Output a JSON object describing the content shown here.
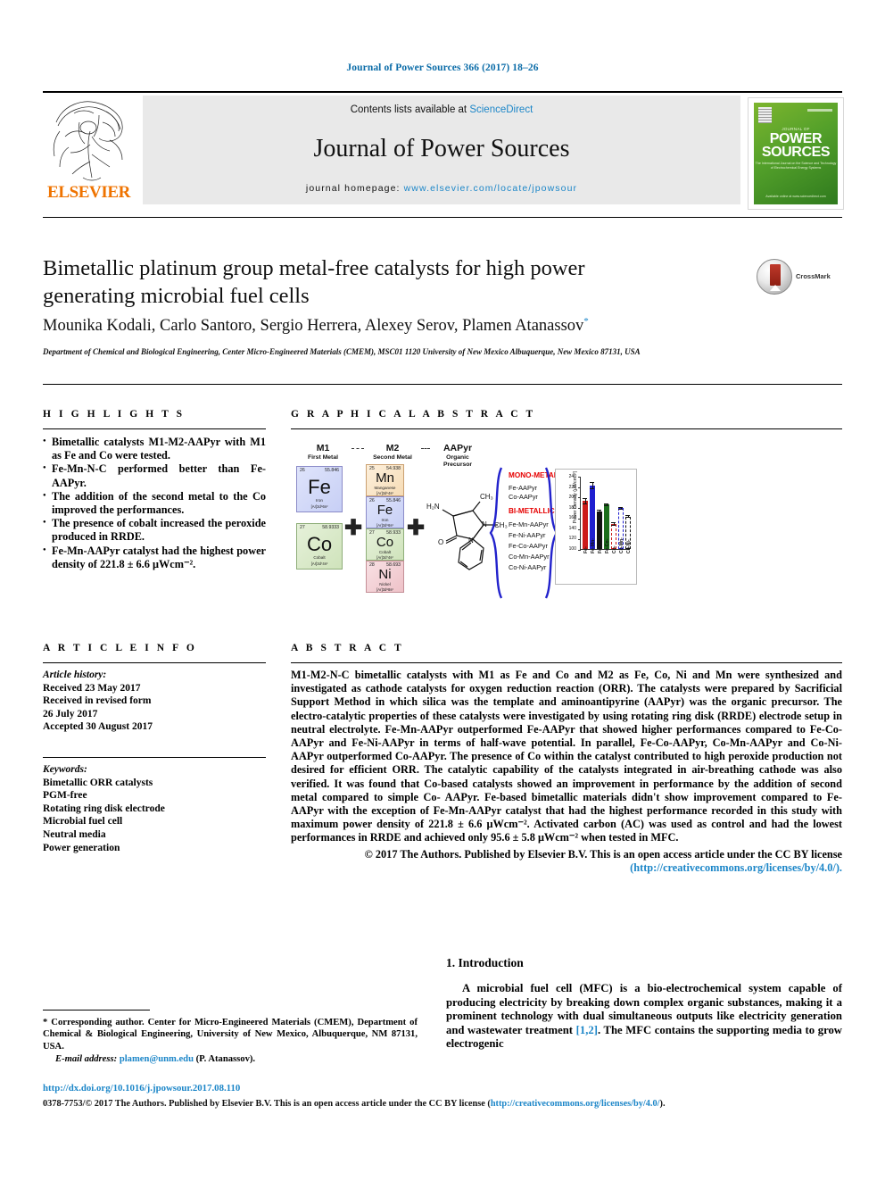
{
  "running_head": "Journal of Power Sources 366 (2017) 18–26",
  "masthead": {
    "publisher": "ELSEVIER",
    "contents_prefix": "Contents lists available at ",
    "contents_link": "ScienceDirect",
    "journal_name": "Journal of Power Sources",
    "homepage_prefix": "journal homepage: ",
    "homepage_url": "www.elsevier.com/locate/jpowsour",
    "cover": {
      "supertitle": "JOURNAL OF",
      "title_line1": "POWER",
      "title_line2": "SOURCES",
      "blurb": "The International Journal on the Science and Technology of Electrochemical Energy Systems",
      "footer": "Available online at www.sciencedirect.com"
    }
  },
  "article": {
    "title": "Bimetallic platinum group metal-free catalysts for high power generating microbial fuel cells",
    "authors": "Mounika Kodali, Carlo Santoro, Sergio Herrera, Alexey Serov, Plamen Atanassov",
    "author_marker": "*",
    "affiliation": "Department of Chemical and Biological Engineering, Center Micro-Engineered Materials (CMEM), MSC01 1120 University of New Mexico Albuquerque, New Mexico 87131, USA",
    "crossmark_label": "CrossMark"
  },
  "highlights": {
    "heading": "H I G H L I G H T S",
    "items": [
      "Bimetallic catalysts M1-M2-AAPyr with M1 as Fe and Co were tested.",
      "Fe-Mn-N-C performed better than Fe-AAPyr.",
      "The addition of the second metal to the Co improved the performances.",
      "The presence of cobalt increased the peroxide produced in RRDE.",
      "Fe-Mn-AAPyr catalyst had the highest power density of 221.8 ± 6.6 μWcm⁻²."
    ]
  },
  "graphical_abstract": {
    "heading": "G R A P H I C A L   A B S T R A C T",
    "columns": [
      {
        "label": "M1",
        "sub": "First Metal"
      },
      {
        "label": "M2",
        "sub": "Second Metal"
      },
      {
        "label": "AAPyr",
        "sub": "Organic\nPrecursor"
      }
    ],
    "m1_elements": [
      {
        "number": "26",
        "mass": "55.846",
        "symbol": "Fe",
        "name": "Iron",
        "config": "[Ar]3d⁶6s²"
      },
      {
        "number": "27",
        "mass": "58.9333",
        "symbol": "Co",
        "name": "Cobalt",
        "config": "[Ar]3d⁷4s²"
      }
    ],
    "m2_elements": [
      {
        "number": "25",
        "mass": "54.938",
        "symbol": "Mn",
        "name": "Manganese",
        "config": "[Ar]3d⁵4s²"
      },
      {
        "number": "26",
        "mass": "55.846",
        "symbol": "Fe",
        "name": "Iron",
        "config": "[Ar]3d⁶6s²"
      },
      {
        "number": "27",
        "mass": "58.933",
        "symbol": "Co",
        "name": "Cobalt",
        "config": "[Ar]3d⁷4s²"
      },
      {
        "number": "28",
        "mass": "58.693",
        "symbol": "Ni",
        "name": "Nickel",
        "config": "[Ar]3d⁸8s²"
      }
    ],
    "plus_symbol": "✚",
    "molecule": {
      "label_nh2": "H₂N",
      "label_ch3_a": "CH₃",
      "label_ch3_b": "CH₃",
      "label_n": "N",
      "label_o": "O"
    },
    "mono_title": "MONO-METALLIC",
    "mono_items": [
      "Fe-AAPyr",
      "Co-AAPyr"
    ],
    "bi_title": "BI-METALLIC",
    "bi_items": [
      "Fe-Mn-AAPyr",
      "Fe-Ni-AAPyr",
      "Fe-Co-AAPyr",
      "Co-Mn-AAPyr",
      "Co-Ni-AAPyr"
    ]
  },
  "chart_data": {
    "type": "bar",
    "title": "",
    "xlabel": "",
    "ylabel": "Power Density (μWcm⁻²)",
    "ylim": [
      100,
      240
    ],
    "yticks": [
      240,
      220,
      200,
      180,
      160,
      140,
      120,
      100
    ],
    "grid": false,
    "legend": "none",
    "categories": [
      "Fe-",
      "Fe-Mn-",
      "Fe-Ni-",
      "Fe-Co-",
      "Co-",
      "Co-Mn-",
      "Co-Ni-"
    ],
    "values": [
      192,
      221.8,
      172,
      185,
      148,
      178,
      162
    ],
    "errors": [
      6.0,
      6.6,
      3.0,
      2.5,
      3.0,
      3.0,
      3.0
    ],
    "bar_colors": [
      "#cc1b1b",
      "#1f1fd0",
      "#111111",
      "#1c6e1c",
      "#cc1b1b",
      "#1f1fd0",
      "#111111"
    ],
    "bar_fill": [
      "solid",
      "solid",
      "solid",
      "solid",
      "hollow",
      "hollow",
      "hollow"
    ]
  },
  "article_info": {
    "heading": "A R T I C L E   I N F O",
    "history_label": "Article history:",
    "history": [
      "Received 23 May 2017",
      "Received in revised form",
      "26 July 2017",
      "Accepted 30 August 2017"
    ],
    "keywords_label": "Keywords:",
    "keywords": [
      "Bimetallic ORR catalysts",
      "PGM-free",
      "Rotating ring disk electrode",
      "Microbial fuel cell",
      "Neutral media",
      "Power generation"
    ]
  },
  "abstract": {
    "heading": "A B S T R A C T",
    "body": "M1-M2-N-C bimetallic catalysts with M1 as Fe and Co and M2 as Fe, Co, Ni and Mn were synthesized and investigated as cathode catalysts for oxygen reduction reaction (ORR). The catalysts were prepared by Sacrificial Support Method in which silica was the template and aminoantipyrine (AAPyr) was the organic precursor. The electro-catalytic properties of these catalysts were investigated by using rotating ring disk (RRDE) electrode setup in neutral electrolyte. Fe-Mn-AAPyr outperformed Fe-AAPyr that showed higher performances compared to Fe-Co-AAPyr and Fe-Ni-AAPyr in terms of half-wave potential. In parallel, Fe-Co-AAPyr, Co-Mn-AAPyr and Co-Ni-AAPyr outperformed Co-AAPyr. The presence of Co within the catalyst contributed to high peroxide production not desired for efficient ORR. The catalytic capability of the catalysts integrated in air-breathing cathode was also verified. It was found that Co-based catalysts showed an improvement in performance by the addition of second metal compared to simple Co- AAPyr. Fe-based bimetallic materials didn't show improvement compared to Fe-AAPyr with the exception of Fe-Mn-AAPyr catalyst that had the highest performance recorded in this study with maximum power density of 221.8 ± 6.6 μWcm⁻². Activated carbon (AC) was used as control and had the lowest performances in RRDE and achieved only 95.6 ± 5.8 μWcm⁻² when tested in MFC.",
    "copyright": "© 2017 The Authors. Published by Elsevier B.V. This is an open access article under the CC BY license",
    "license_url": "(http://creativecommons.org/licenses/by/4.0/)."
  },
  "introduction": {
    "heading": "1. Introduction",
    "paragraph_pre": "A microbial fuel cell (MFC) is a bio-electrochemical system capable of producing electricity by breaking down complex organic substances, making it a prominent technology with dual simultaneous outputs like electricity generation and wastewater treatment ",
    "citation": "[1,2]",
    "paragraph_post": ". The MFC contains the supporting media to grow electrogenic"
  },
  "footnote": {
    "marker": "*",
    "text": " Corresponding author. Center for Micro-Engineered Materials (CMEM), Department of Chemical & Biological Engineering, University of New Mexico, Albuquerque, NM 87131, USA.",
    "email_label": "E-mail address:",
    "email": "plamen@unm.edu",
    "email_owner": "(P. Atanassov)."
  },
  "footer": {
    "doi": "http://dx.doi.org/10.1016/j.jpowsour.2017.08.110",
    "issn_prefix": "0378-7753/",
    "issn_text": "© 2017 The Authors. Published by Elsevier B.V. This is an open access article under the CC BY license (",
    "issn_link": "http://creativecommons.org/licenses/by/4.0/",
    "issn_suffix": ")."
  },
  "colors": {
    "link": "#1c86c8",
    "elsevier_orange": "#ef7300",
    "accent_red": "#e60000",
    "brace_blue": "#2222cc"
  }
}
